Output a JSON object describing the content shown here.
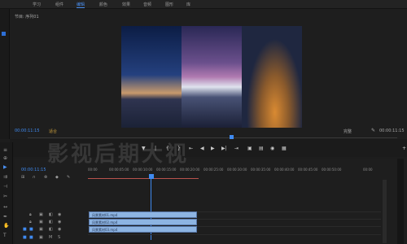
{
  "topbar": {
    "tabs": [
      "学习",
      "组件",
      "编辑",
      "颜色",
      "效果",
      "音频",
      "图形",
      "库"
    ],
    "active_tab": "编辑"
  },
  "monitor": {
    "title": "节目: 序列01",
    "timecode_left": "00:00:11:15",
    "fit_label": "适合",
    "quality_label": "完整",
    "timecode_right": "00:00:11:15"
  },
  "timeline": {
    "timecode": "00:00:11:15",
    "ruler_ticks": [
      "00:00",
      "00:00:05:00",
      "00:00:10:00",
      "00:00:15:00",
      "00:00:20:00",
      "00:00:25:00",
      "00:00:30:00",
      "00:00:35:00",
      "00:00:40:00",
      "00:00:45:00",
      "00:00:50:00",
      "00:00"
    ],
    "clips": [
      {
        "label": "风景素材01.mp4"
      },
      {
        "label": "风景素材02.mp4"
      },
      {
        "label": "风景素材03.mp4"
      }
    ],
    "track_names": [
      "V3",
      "V2",
      "V1",
      "A1",
      "A2"
    ]
  },
  "watermark": "影视后期大视",
  "colors": {
    "accent": "#3f8af0",
    "clip": "#8db4e2",
    "work_area": "#b8524c",
    "watermark": "#ffffff"
  },
  "icons": [
    "wrench-icon",
    "play-icon",
    "step-back-icon",
    "step-forward-icon",
    "camera-icon",
    "mark-in-icon",
    "mark-out-icon",
    "razor-icon",
    "pen-icon",
    "hand-icon",
    "text-icon",
    "eye-icon",
    "lock-icon"
  ]
}
